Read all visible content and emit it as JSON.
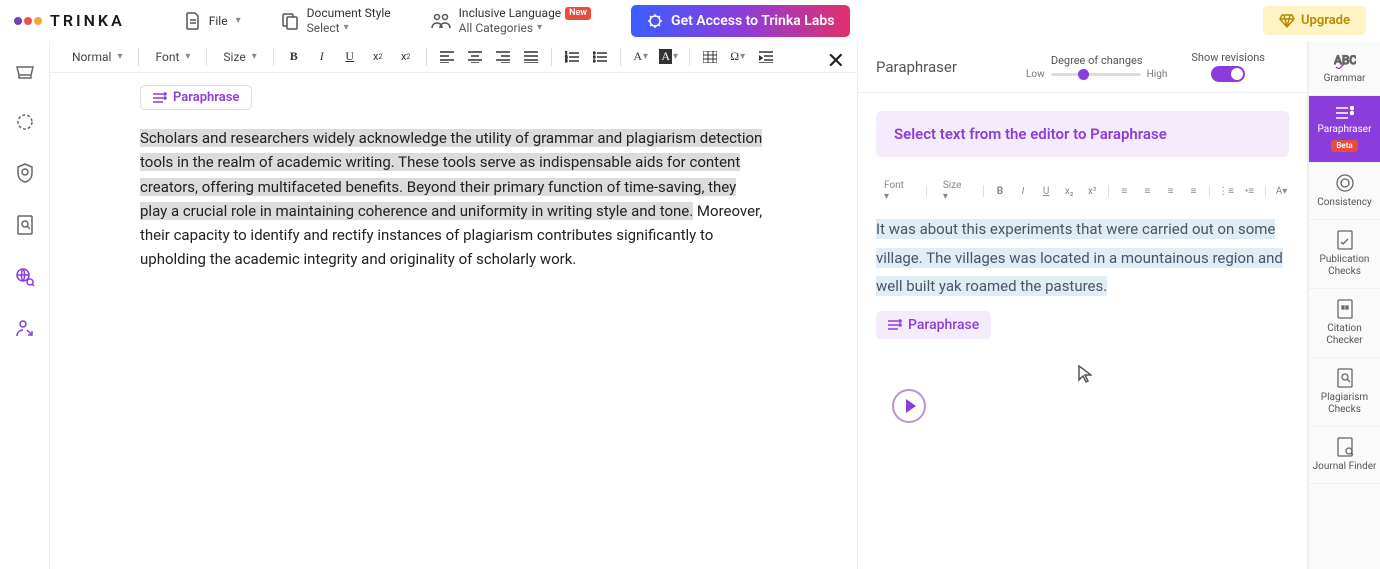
{
  "brand": "TRINKA",
  "brand_dots": [
    "#7b3fb5",
    "#e8564c",
    "#f2a63c"
  ],
  "topbar": {
    "file": "File",
    "doc_style_label": "Document Style",
    "doc_style_value": "Select",
    "inclusive_label": "Inclusive Language",
    "inclusive_value": "All Categories",
    "new_badge": "New",
    "labs_button": "Get Access to Trinka Labs",
    "upgrade": "Upgrade"
  },
  "editor_toolbar": {
    "para_style": "Normal",
    "font": "Font",
    "size": "Size"
  },
  "paraphrase_tag": "Paraphrase",
  "document": {
    "highlighted": "Scholars and researchers widely acknowledge the utility of grammar and plagiarism detection tools in the realm of academic writing. These tools serve as indispensable aids for content creators, offering multifaceted benefits. Beyond their primary function of time-saving, they play a crucial role in maintaining coherence and uniformity in writing style and tone.",
    "rest": " Moreover, their capacity to identify and rectify instances of plagiarism contributes significantly to upholding the academic integrity and originality of scholarly work."
  },
  "paraphraser": {
    "title": "Paraphraser",
    "degree_label": "Degree of changes",
    "low": "Low",
    "high": "High",
    "revisions_label": "Show revisions",
    "prompt": "Select text from the editor to Paraphrase",
    "mini_font": "Font",
    "mini_size": "Size",
    "sample_text": "It was about this experiments that were carried out on some village. The villages was located in a mountainous region and well built yak roamed the pastures.",
    "inline_btn": "Paraphrase"
  },
  "right_tools": {
    "grammar": "Grammar",
    "paraphraser": "Paraphraser",
    "beta": "Beta",
    "consistency": "Consistency",
    "publication": "Publication Checks",
    "citation": "Citation Checker",
    "plagiarism": "Plagiarism Checks",
    "journal": "Journal Finder"
  }
}
